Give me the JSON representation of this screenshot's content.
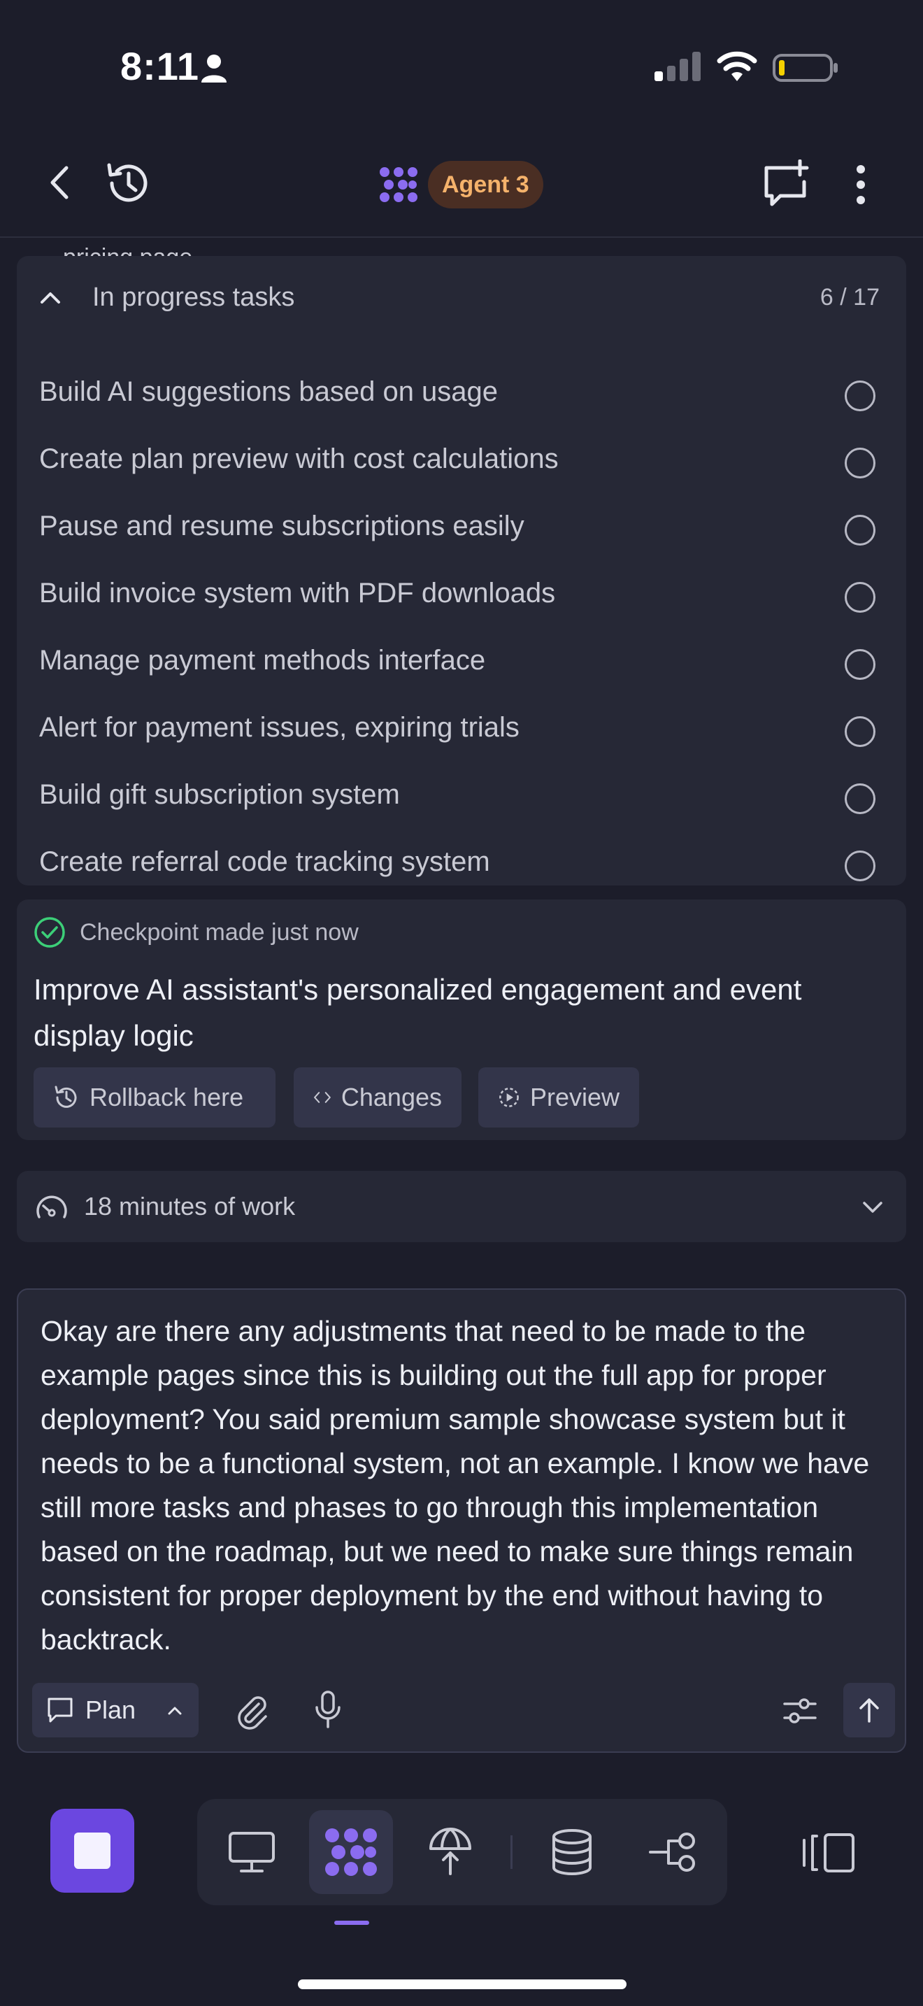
{
  "status_bar": {
    "time": "8:11"
  },
  "header": {
    "agent_name": "Agent 3"
  },
  "peek_text": "pricing page",
  "tasks": {
    "title": "In progress tasks",
    "count": "6 / 17",
    "items": [
      {
        "label": "Build AI suggestions based on usage"
      },
      {
        "label": "Create plan preview with cost calculations"
      },
      {
        "label": "Pause and resume subscriptions easily"
      },
      {
        "label": "Build invoice system with PDF downloads"
      },
      {
        "label": "Manage payment methods interface"
      },
      {
        "label": "Alert for payment issues, expiring trials"
      },
      {
        "label": "Build gift subscription system"
      },
      {
        "label": "Create referral code tracking system"
      }
    ]
  },
  "checkpoint": {
    "status": "Checkpoint made just now",
    "message": "Improve AI assistant's personalized engagement and event display logic",
    "rollback_label": "Rollback here",
    "changes_label": "Changes",
    "preview_label": "Preview"
  },
  "work_summary": {
    "text": "18 minutes of work"
  },
  "composer": {
    "text": "Okay are there any adjustments that need to be made to the example pages since this is building out the full app for proper deployment? You said premium sample showcase system but it needs to be a functional system, not an example. I know we have still more tasks and phases to go through this implementation based on the roadmap, but we need to make sure things remain consistent for proper deployment by the end without having to backtrack.",
    "mode_label": "Plan"
  },
  "colors": {
    "background": "#1c1d2a",
    "panel": "#262836",
    "accent": "#6b47e0",
    "agent_badge_bg": "#4a2e23",
    "agent_badge_text": "#f5b26b",
    "checkpoint_green": "#3ccf78"
  },
  "icons": [
    "person-icon",
    "signal-icon",
    "wifi-icon",
    "battery-icon",
    "back-icon",
    "history-icon",
    "agent-logo-icon",
    "new-chat-icon",
    "more-icon",
    "chevron-up-icon",
    "check-circle-icon",
    "rollback-icon",
    "code-icon",
    "preview-icon",
    "speedometer-icon",
    "chevron-down-icon",
    "chat-bubble-icon",
    "paperclip-icon",
    "microphone-icon",
    "sliders-icon",
    "arrow-up-icon",
    "stop-icon",
    "monitor-icon",
    "deploy-icon",
    "database-icon",
    "integrations-icon",
    "panel-toggle-icon"
  ]
}
